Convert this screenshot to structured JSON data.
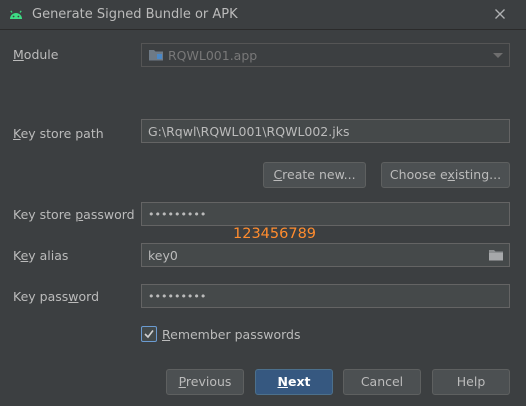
{
  "window": {
    "title": "Generate Signed Bundle or APK",
    "icon": "android-icon",
    "close_icon": "close-icon"
  },
  "module": {
    "label_prefix": "",
    "label_mnemonic": "M",
    "label_rest": "odule",
    "value": "RQWL001.app",
    "icon": "module-folder-icon"
  },
  "key_store_path": {
    "label_mnemonic": "K",
    "label_rest": "ey store path",
    "value": "G:\\Rqwl\\RQWL001\\RQWL002.jks"
  },
  "buttons": {
    "create_new_mnemonic": "C",
    "create_new_rest": "reate new...",
    "choose_existing_mnemonic": "Choose e",
    "choose_existing_underlined": "x",
    "choose_existing_rest": "isting...",
    "previous_mnemonic": "P",
    "previous_rest": "revious",
    "next_mnemonic": "N",
    "next_rest": "ext",
    "cancel": "Cancel",
    "help": "Help"
  },
  "key_store_password": {
    "label_pre": "Key store ",
    "label_mnemonic": "p",
    "label_rest": "assword",
    "value": "•••••••••"
  },
  "annotation": {
    "text": "123456789",
    "color": "#ff8c2e"
  },
  "key_alias": {
    "label_pre": "K",
    "label_mnemonic": "e",
    "label_rest": "y alias",
    "value": "key0"
  },
  "key_password": {
    "label_pre": "Key pass",
    "label_mnemonic": "w",
    "label_rest": "ord",
    "value": "•••••••••"
  },
  "remember_passwords": {
    "label_mnemonic": "R",
    "label_rest": "emember passwords",
    "checked": true
  },
  "colors": {
    "background": "#3c3f41",
    "field": "#45494a",
    "primary_button": "#365880",
    "android_green": "#3ddc84"
  }
}
